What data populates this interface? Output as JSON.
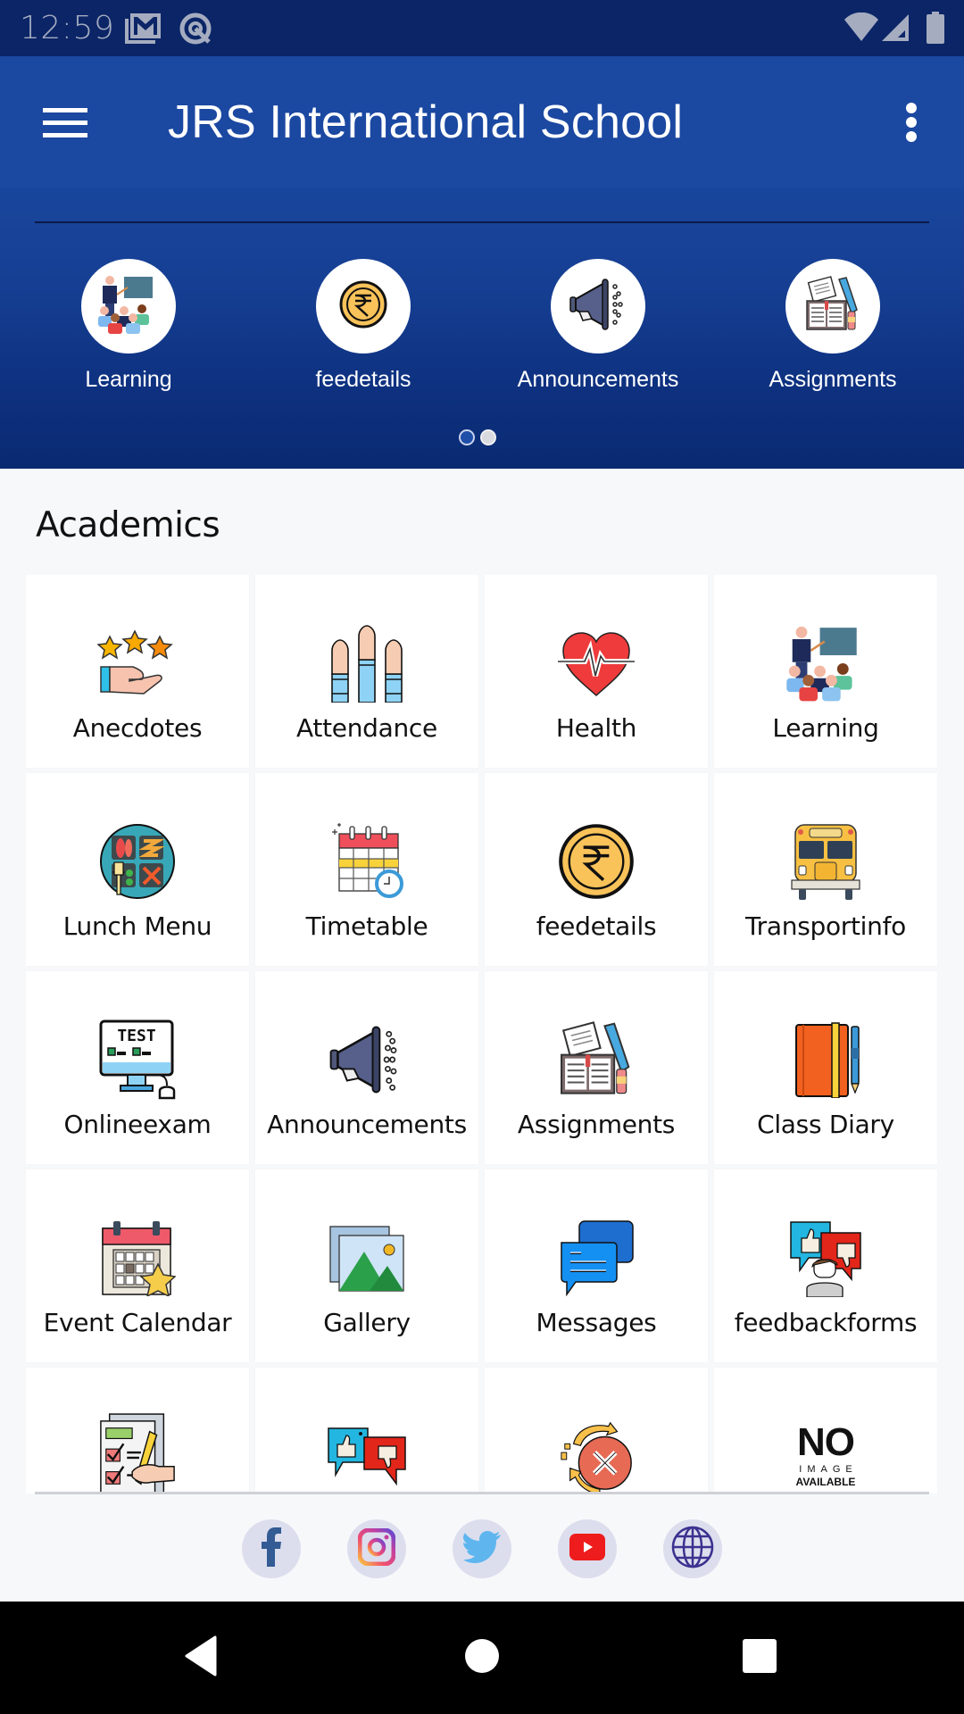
{
  "status_bar": {
    "time": "12:59",
    "notification_icons": [
      "gmail-icon",
      "q-app-icon"
    ],
    "system_icons": [
      "wifi-icon",
      "cell-signal-icon",
      "battery-icon"
    ]
  },
  "toolbar": {
    "title": "JRS International School",
    "menu_icon": "hamburger-menu-icon",
    "overflow_icon": "more-vertical-icon"
  },
  "carousel": {
    "items": [
      {
        "label": "Learning",
        "icon": "teacher-classroom-icon"
      },
      {
        "label": "feedetails",
        "icon": "rupee-coin-icon"
      },
      {
        "label": "Announcements",
        "icon": "megaphone-icon"
      },
      {
        "label": "Assignments",
        "icon": "book-pencil-icon"
      }
    ],
    "pages": 2,
    "active_page": 1
  },
  "section": {
    "title": "Academics"
  },
  "grid": {
    "items": [
      {
        "label": "Anecdotes",
        "icon": "stars-hand-icon"
      },
      {
        "label": "Attendance",
        "icon": "raised-hands-icon"
      },
      {
        "label": "Health",
        "icon": "heart-pulse-icon"
      },
      {
        "label": "Learning",
        "icon": "teacher-classroom-icon"
      },
      {
        "label": "Lunch Menu",
        "icon": "lunch-plate-icon"
      },
      {
        "label": "Timetable",
        "icon": "calendar-clock-icon"
      },
      {
        "label": "feedetails",
        "icon": "rupee-coin-icon"
      },
      {
        "label": "Transportinfo",
        "icon": "school-bus-icon"
      },
      {
        "label": "Onlineexam",
        "icon": "test-monitor-icon"
      },
      {
        "label": "Announcements",
        "icon": "megaphone-icon"
      },
      {
        "label": "Assignments",
        "icon": "book-pencil-icon"
      },
      {
        "label": "Class Diary",
        "icon": "diary-pen-icon"
      },
      {
        "label": "Event Calendar",
        "icon": "calendar-star-icon"
      },
      {
        "label": "Gallery",
        "icon": "gallery-image-icon"
      },
      {
        "label": "Messages",
        "icon": "chat-bubbles-icon"
      },
      {
        "label": "feedbackforms",
        "icon": "feedback-person-icon"
      },
      {
        "label": "",
        "icon": "checklist-form-icon"
      },
      {
        "label": "",
        "icon": "thumbs-feedback-icon"
      },
      {
        "label": "",
        "icon": "cancel-refresh-icon"
      },
      {
        "label": "",
        "icon": "no-image-placeholder",
        "placeholder_text": {
          "big": "NO",
          "mid": "IMAGE",
          "small": "AVAILABLE"
        }
      }
    ]
  },
  "social": {
    "items": [
      {
        "name": "facebook",
        "icon": "facebook-icon"
      },
      {
        "name": "instagram",
        "icon": "instagram-icon"
      },
      {
        "name": "twitter",
        "icon": "twitter-icon"
      },
      {
        "name": "youtube",
        "icon": "youtube-icon"
      },
      {
        "name": "website",
        "icon": "globe-icon"
      }
    ]
  },
  "nav_bar": {
    "buttons": [
      "back",
      "home",
      "recents"
    ]
  },
  "colors": {
    "toolbar": "#1b48a1",
    "header_bottom": "#0a2a72",
    "status_bar": "#0b2567",
    "background": "#f7f8fa",
    "social_bg": "#dcdeee"
  }
}
